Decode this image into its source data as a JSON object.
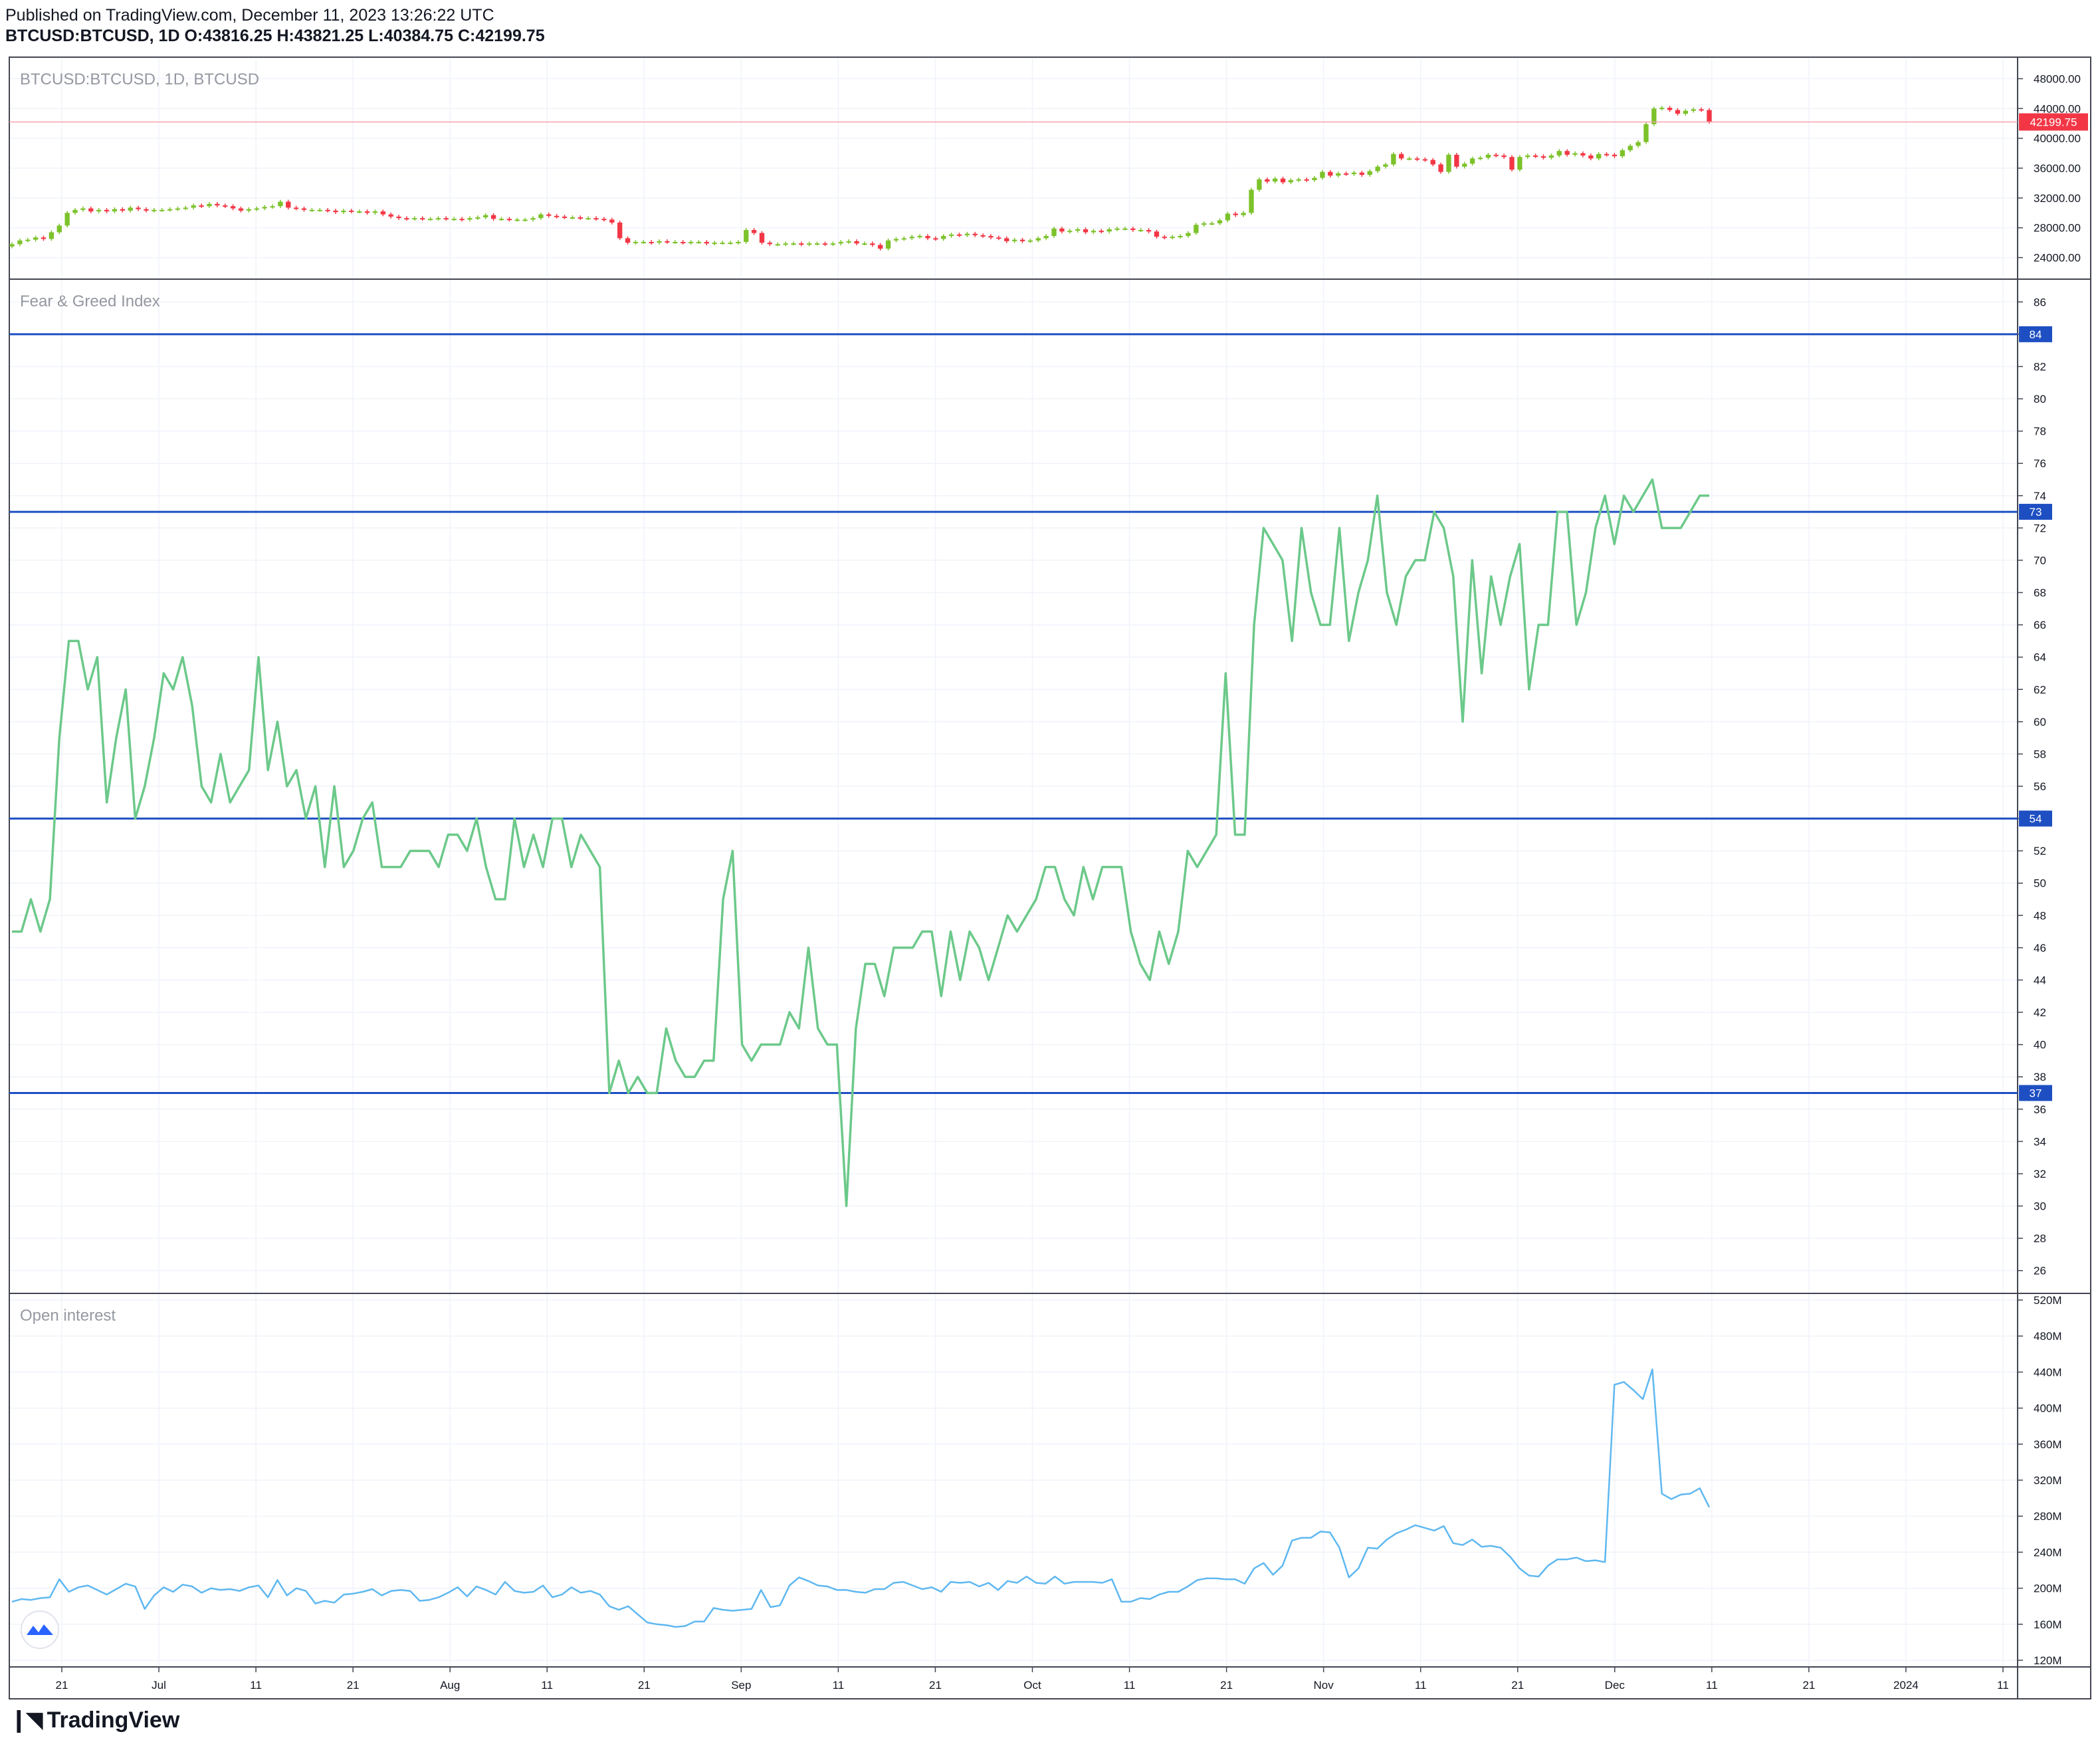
{
  "header": {
    "published": "Published on TradingView.com, December 11, 2023 13:26:22 UTC",
    "symbol": "BTCUSD:BTCUSD, 1D",
    "o_label": "O:",
    "o_value": "43816.25",
    "h_label": "H:",
    "h_value": "43821.25",
    "l_label": "L:",
    "l_value": "40384.75",
    "c_label": "C:",
    "c_value": "42199.75"
  },
  "panes": {
    "price_title": "BTCUSD:BTCUSD, 1D, BTCUSD",
    "fg_title": "Fear & Greed Index",
    "oi_title": "Open interest"
  },
  "footer": {
    "logo_text": "TradingView"
  },
  "colors": {
    "up": "#7cc22a",
    "down": "#f23645",
    "fg_line": "#6cc98a",
    "oi_line": "#5fb8f0",
    "hline": "#1e4fc2",
    "last_price_bg": "#f23645",
    "grid": "#f0f3fa"
  },
  "chart_data": [
    {
      "type": "candlestick",
      "title": "BTCUSD:BTCUSD, 1D, BTCUSD",
      "ylim": [
        22000,
        50000
      ],
      "y_ticks": [
        "48000.00",
        "44000.00",
        "40000.00",
        "36000.00",
        "32000.00",
        "28000.00",
        "24000.00"
      ],
      "y_tick_values": [
        48000,
        44000,
        40000,
        36000,
        32000,
        28000,
        24000
      ],
      "last_price": 42199.75,
      "last_price_label": "42199.75",
      "closes": [
        25800,
        26300,
        26400,
        26700,
        26500,
        27400,
        28300,
        30000,
        30400,
        30600,
        30200,
        30400,
        30200,
        30500,
        30300,
        30700,
        30500,
        30300,
        30400,
        30400,
        30500,
        30600,
        30700,
        31000,
        30900,
        31200,
        31000,
        30900,
        30600,
        30300,
        30500,
        30600,
        30800,
        30900,
        31500,
        30700,
        30600,
        30400,
        30400,
        30400,
        30300,
        30100,
        30300,
        30200,
        30200,
        30000,
        30200,
        29800,
        29500,
        29300,
        29200,
        29300,
        29200,
        29200,
        29300,
        29200,
        29200,
        29100,
        29300,
        29400,
        29700,
        29200,
        29200,
        29100,
        29100,
        29100,
        29300,
        29800,
        29600,
        29500,
        29400,
        29400,
        29300,
        29300,
        29200,
        29100,
        28700,
        26600,
        26000,
        26100,
        26100,
        26000,
        26200,
        26100,
        26100,
        26000,
        26100,
        26100,
        25900,
        26000,
        26000,
        26000,
        26100,
        27700,
        27300,
        26000,
        25800,
        25800,
        25900,
        25900,
        25800,
        25900,
        25900,
        25800,
        25900,
        26100,
        26200,
        25900,
        25900,
        25700,
        25200,
        26300,
        26500,
        26600,
        26800,
        26900,
        26600,
        26500,
        26900,
        27100,
        27000,
        27200,
        27000,
        26900,
        26700,
        26600,
        26200,
        26400,
        26200,
        26300,
        26600,
        26900,
        27900,
        27500,
        27600,
        27800,
        27400,
        27600,
        27500,
        27800,
        27900,
        27900,
        27700,
        27700,
        27500,
        26800,
        26700,
        26800,
        26900,
        27300,
        28400,
        28600,
        28600,
        29000,
        29900,
        29700,
        30000,
        33100,
        34500,
        34200,
        34600,
        34100,
        34400,
        34500,
        34400,
        34700,
        35500,
        35000,
        35300,
        35200,
        35400,
        35100,
        35600,
        36200,
        36500,
        37900,
        37300,
        37300,
        37200,
        37100,
        36500,
        35500,
        37800,
        36200,
        36600,
        37300,
        37400,
        37800,
        37700,
        37500,
        35800,
        37500,
        37700,
        37600,
        37400,
        37700,
        38300,
        37800,
        38000,
        37700,
        37300,
        37900,
        37800,
        37600,
        38400,
        39000,
        39500,
        41900,
        44000,
        44100,
        43800,
        43300,
        43700,
        43900,
        43800,
        42199
      ]
    },
    {
      "type": "line",
      "title": "Fear & Greed Index",
      "ylim": [
        25,
        87
      ],
      "y_ticks": [
        "86",
        "84",
        "82",
        "80",
        "78",
        "76",
        "74",
        "72",
        "70",
        "68",
        "66",
        "64",
        "62",
        "60",
        "58",
        "56",
        "54",
        "52",
        "50",
        "48",
        "46",
        "44",
        "42",
        "40",
        "38",
        "36",
        "34",
        "32",
        "30",
        "28",
        "26"
      ],
      "y_tick_values": [
        86,
        84,
        82,
        80,
        78,
        76,
        74,
        72,
        70,
        68,
        66,
        64,
        62,
        60,
        58,
        56,
        54,
        52,
        50,
        48,
        46,
        44,
        42,
        40,
        38,
        36,
        34,
        32,
        30,
        28,
        26
      ],
      "hlines": [
        84,
        73,
        54,
        37
      ],
      "hline_labels": [
        "84",
        "73",
        "54",
        "37"
      ],
      "values": [
        47,
        47,
        49,
        47,
        49,
        59,
        65,
        65,
        62,
        64,
        55,
        59,
        62,
        54,
        56,
        59,
        63,
        62,
        64,
        61,
        56,
        55,
        58,
        55,
        56,
        57,
        64,
        57,
        60,
        56,
        57,
        54,
        56,
        51,
        56,
        51,
        52,
        54,
        55,
        51,
        51,
        51,
        52,
        52,
        52,
        51,
        53,
        53,
        52,
        54,
        51,
        49,
        49,
        54,
        51,
        53,
        51,
        54,
        54,
        51,
        53,
        52,
        51,
        37,
        39,
        37,
        38,
        37,
        37,
        41,
        39,
        38,
        38,
        39,
        39,
        49,
        52,
        40,
        39,
        40,
        40,
        40,
        42,
        41,
        46,
        41,
        40,
        40,
        30,
        41,
        45,
        45,
        43,
        46,
        46,
        46,
        47,
        47,
        43,
        47,
        44,
        47,
        46,
        44,
        46,
        48,
        47,
        48,
        49,
        51,
        51,
        49,
        48,
        51,
        49,
        51,
        51,
        51,
        47,
        45,
        44,
        47,
        45,
        47,
        52,
        51,
        52,
        53,
        63,
        53,
        53,
        66,
        72,
        71,
        70,
        65,
        72,
        68,
        66,
        66,
        72,
        65,
        68,
        70,
        74,
        68,
        66,
        69,
        70,
        70,
        73,
        72,
        69,
        60,
        70,
        63,
        69,
        66,
        69,
        71,
        62,
        66,
        66,
        73,
        73,
        66,
        68,
        72,
        74,
        71,
        74,
        73,
        74,
        75,
        72,
        72,
        72,
        73,
        74,
        74
      ]
    },
    {
      "type": "line",
      "title": "Open interest",
      "ylim": [
        120,
        520
      ],
      "y_ticks": [
        "520M",
        "480M",
        "440M",
        "400M",
        "360M",
        "320M",
        "280M",
        "240M",
        "200M",
        "160M",
        "120M"
      ],
      "y_tick_values": [
        520,
        480,
        440,
        400,
        360,
        320,
        280,
        240,
        200,
        160,
        120
      ],
      "values": [
        185,
        188,
        187,
        189,
        190,
        210,
        196,
        201,
        203,
        198,
        193,
        199,
        205,
        202,
        177,
        192,
        201,
        196,
        204,
        202,
        195,
        200,
        198,
        199,
        197,
        201,
        203,
        190,
        209,
        192,
        200,
        197,
        183,
        186,
        184,
        193,
        194,
        196,
        199,
        192,
        197,
        198,
        197,
        186,
        187,
        190,
        195,
        201,
        191,
        202,
        198,
        193,
        207,
        197,
        195,
        196,
        203,
        190,
        193,
        201,
        195,
        197,
        193,
        180,
        176,
        180,
        171,
        162,
        160,
        159,
        157,
        158,
        163,
        163,
        178,
        176,
        175,
        176,
        177,
        198,
        179,
        181,
        203,
        212,
        208,
        203,
        202,
        198,
        198,
        196,
        195,
        199,
        199,
        206,
        207,
        203,
        199,
        201,
        196,
        207,
        206,
        207,
        202,
        206,
        198,
        208,
        206,
        213,
        206,
        205,
        213,
        205,
        207,
        207,
        207,
        206,
        210,
        185,
        185,
        189,
        188,
        193,
        196,
        196,
        202,
        209,
        211,
        211,
        210,
        210,
        205,
        222,
        228,
        215,
        225,
        253,
        256,
        256,
        263,
        262,
        245,
        212,
        222,
        245,
        244,
        254,
        261,
        265,
        270,
        267,
        264,
        269,
        250,
        248,
        254,
        246,
        247,
        245,
        235,
        222,
        214,
        213,
        225,
        232,
        232,
        234,
        230,
        231,
        229,
        426,
        429,
        420,
        410,
        443,
        305,
        299,
        304,
        305,
        311,
        290
      ]
    }
  ],
  "time_axis": [
    "21",
    "Jul",
    "11",
    "21",
    "Aug",
    "11",
    "21",
    "Sep",
    "11",
    "21",
    "Oct",
    "11",
    "21",
    "Nov",
    "11",
    "21",
    "Dec",
    "11",
    "21",
    "2024",
    "11"
  ]
}
